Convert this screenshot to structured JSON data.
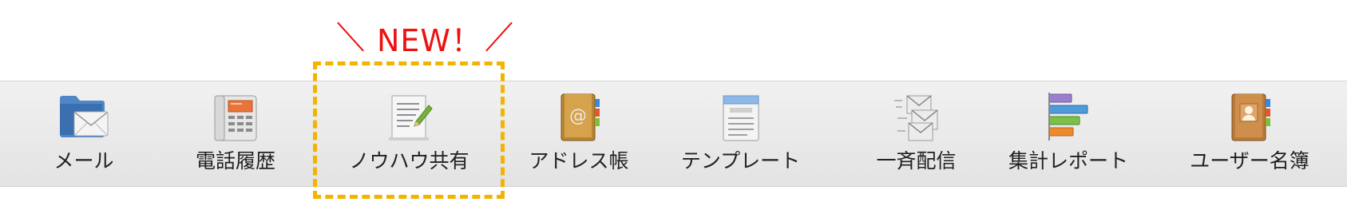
{
  "callout": {
    "text": "NEW！"
  },
  "toolbar": {
    "items": [
      {
        "label": "メール",
        "icon": "mail-folder-icon"
      },
      {
        "label": "電話履歴",
        "icon": "phone-icon"
      },
      {
        "label": "ノウハウ共有",
        "icon": "document-edit-icon"
      },
      {
        "label": "アドレス帳",
        "icon": "address-book-icon"
      },
      {
        "label": "テンプレート",
        "icon": "template-window-icon"
      },
      {
        "label": "一斉配信",
        "icon": "broadcast-mail-icon"
      },
      {
        "label": "集計レポート",
        "icon": "bar-report-icon"
      },
      {
        "label": "ユーザー名簿",
        "icon": "user-directory-icon"
      }
    ]
  },
  "colors": {
    "callout": "#ee1111",
    "highlight_border": "#f2b400",
    "toolbar_bg": "#e9e9e9"
  }
}
